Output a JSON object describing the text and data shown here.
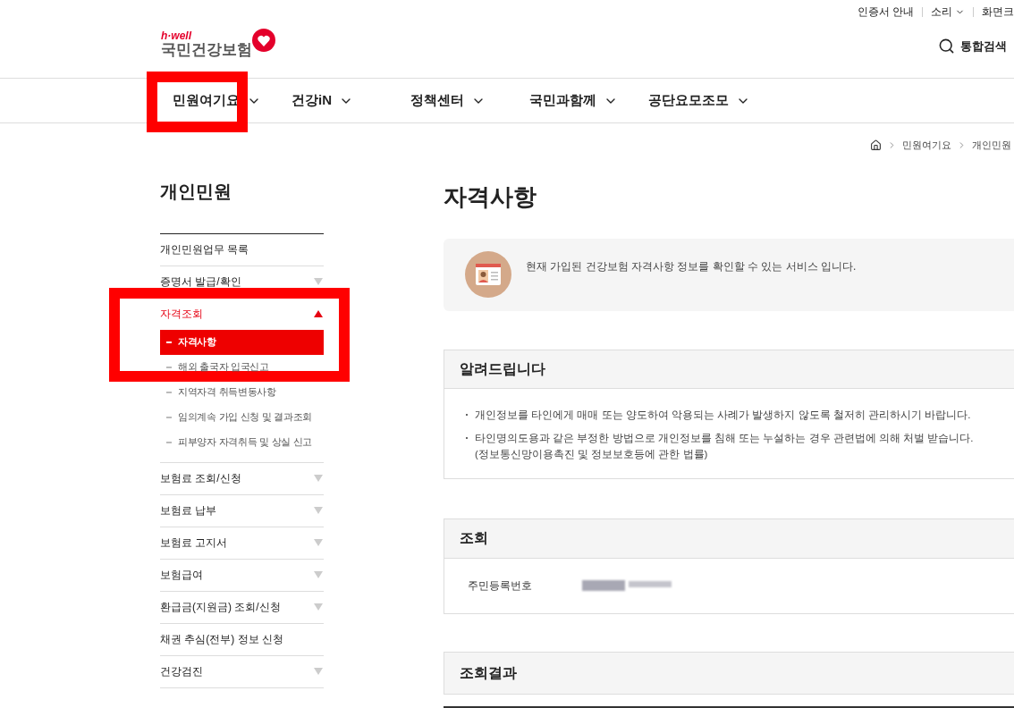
{
  "utility_links": [
    {
      "label": "인증서 안내",
      "dropdown": false
    },
    {
      "label": "소리",
      "dropdown": true
    },
    {
      "label": "화면크",
      "dropdown": false
    }
  ],
  "logo": {
    "tagline": "h·well",
    "name": "국민건강보험"
  },
  "search": {
    "label": "통합검색"
  },
  "nav": [
    {
      "label": "민원여기요",
      "highlighted": true
    },
    {
      "label": "건강iN",
      "highlighted": false
    },
    {
      "label": "정책센터",
      "highlighted": false
    },
    {
      "label": "국민과함께",
      "highlighted": false
    },
    {
      "label": "공단요모조모",
      "highlighted": false
    }
  ],
  "breadcrumb": [
    "민원여기요",
    "개인민원"
  ],
  "sidebar": {
    "title": "개인민원",
    "items": [
      {
        "label": "개인민원업무 목록",
        "kind": "link"
      },
      {
        "label": "증명서 발급/확인",
        "kind": "group",
        "expanded": false,
        "highlighted": false
      },
      {
        "label": "자격조회",
        "kind": "group",
        "expanded": true,
        "highlighted": true,
        "children": [
          {
            "label": "자격사항",
            "selected": true
          },
          {
            "label": "해외 출국자 입국신고",
            "selected": false
          },
          {
            "label": "지역자격 취득변동사항",
            "selected": false
          },
          {
            "label": "임의계속 가입 신청 및 결과조회",
            "selected": false
          },
          {
            "label": "피부양자 자격취득 및 상실 신고",
            "selected": false
          }
        ]
      },
      {
        "label": "보험료 조회/신청",
        "kind": "group",
        "expanded": false,
        "highlighted": false
      },
      {
        "label": "보험료 납부",
        "kind": "group",
        "expanded": false,
        "highlighted": false
      },
      {
        "label": "보험료 고지서",
        "kind": "group",
        "expanded": false,
        "highlighted": false
      },
      {
        "label": "보험급여",
        "kind": "group",
        "expanded": false,
        "highlighted": false
      },
      {
        "label": "환급금(지원금) 조회/신청",
        "kind": "group",
        "expanded": false,
        "highlighted": false
      },
      {
        "label": "채권 추심(전부) 정보 신청",
        "kind": "link"
      },
      {
        "label": "건강검진",
        "kind": "group",
        "expanded": false,
        "highlighted": false
      }
    ]
  },
  "page": {
    "title": "자격사항",
    "intro": "현재 가입된 건강보험 자격사항 정보를 확인할 수 있는 서비스 입니다.",
    "notice": {
      "title": "알려드립니다",
      "items": [
        {
          "text": "개인정보를 타인에게 매매 또는 양도하여 악용되는 사례가 발생하지 않도록 철저히 관리하시기 바랍니다."
        },
        {
          "text": "타인명의도용과 같은 부정한 방법으로 개인정보를 침해 또는 누설하는 경우 관련법에 의해 처벌 받습니다.",
          "note": "(정보통신망이용촉진 및 정보보호등에 관한 법률)"
        }
      ]
    },
    "query": {
      "title": "조회",
      "fields": [
        {
          "label": "주민등록번호",
          "masked": true
        }
      ]
    },
    "results": {
      "title": "조회결과"
    }
  }
}
